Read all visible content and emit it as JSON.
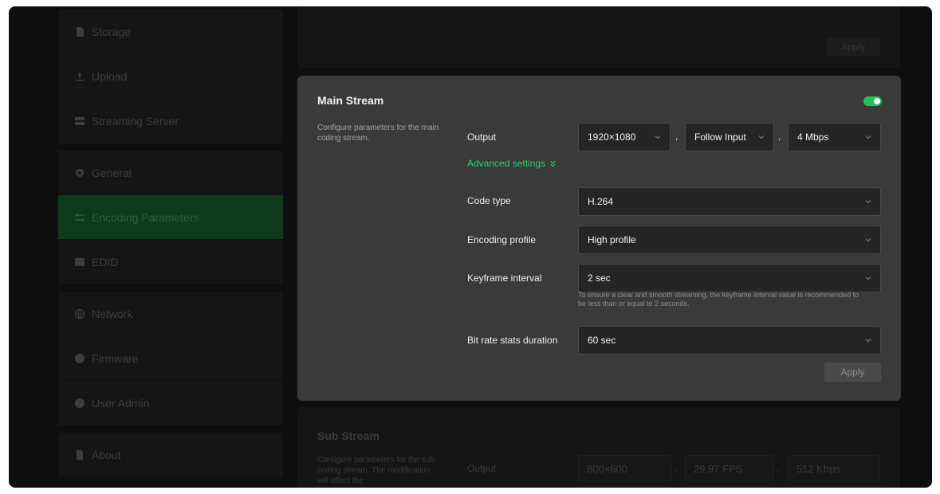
{
  "sidebar": {
    "items": [
      {
        "label": "Storage",
        "icon": "storage-icon"
      },
      {
        "label": "Upload",
        "icon": "upload-icon"
      },
      {
        "label": "Streaming Server",
        "icon": "server-icon"
      },
      {
        "label": "General",
        "icon": "gear-icon"
      },
      {
        "label": "Encoding Parameters",
        "icon": "sliders-icon",
        "active": true
      },
      {
        "label": "EDID",
        "icon": "edid-icon"
      },
      {
        "label": "Network",
        "icon": "globe-icon"
      },
      {
        "label": "Firmware",
        "icon": "info-icon"
      },
      {
        "label": "User Admin",
        "icon": "user-icon"
      },
      {
        "label": "About",
        "icon": "document-icon"
      }
    ]
  },
  "top_panel": {
    "apply_label": "Apply"
  },
  "main_stream": {
    "title": "Main Stream",
    "description": "Configure parameters for the main coding stream.",
    "enabled": true,
    "output_label": "Output",
    "resolution": "1920×1080",
    "framerate": "Follow Input",
    "bitrate": "4 Mbps",
    "separator": ",",
    "advanced_label": "Advanced settings",
    "code_type_label": "Code type",
    "code_type": "H.264",
    "encoding_profile_label": "Encoding profile",
    "encoding_profile": "High profile",
    "keyframe_label": "Keyframe interval",
    "keyframe": "2 sec",
    "keyframe_hint": "To ensure a clear and smooth streaming, the keyframe interval value is recommended to be less than or equal to 2 seconds.",
    "bitrate_stats_label": "Bit rate stats duration",
    "bitrate_stats": "60 sec",
    "apply_label": "Apply"
  },
  "sub_stream": {
    "title": "Sub Stream",
    "description": "Configure parameters for the sub coding stream. The modification will affect the",
    "output_label": "Output",
    "resolution": "800×600",
    "framerate": "29.97 FPS",
    "bitrate": "512 Kbps",
    "separator": ","
  },
  "colors": {
    "accent": "#27c15b",
    "active_nav": "#0d3a1b",
    "modal_bg": "#3a3a3a"
  }
}
